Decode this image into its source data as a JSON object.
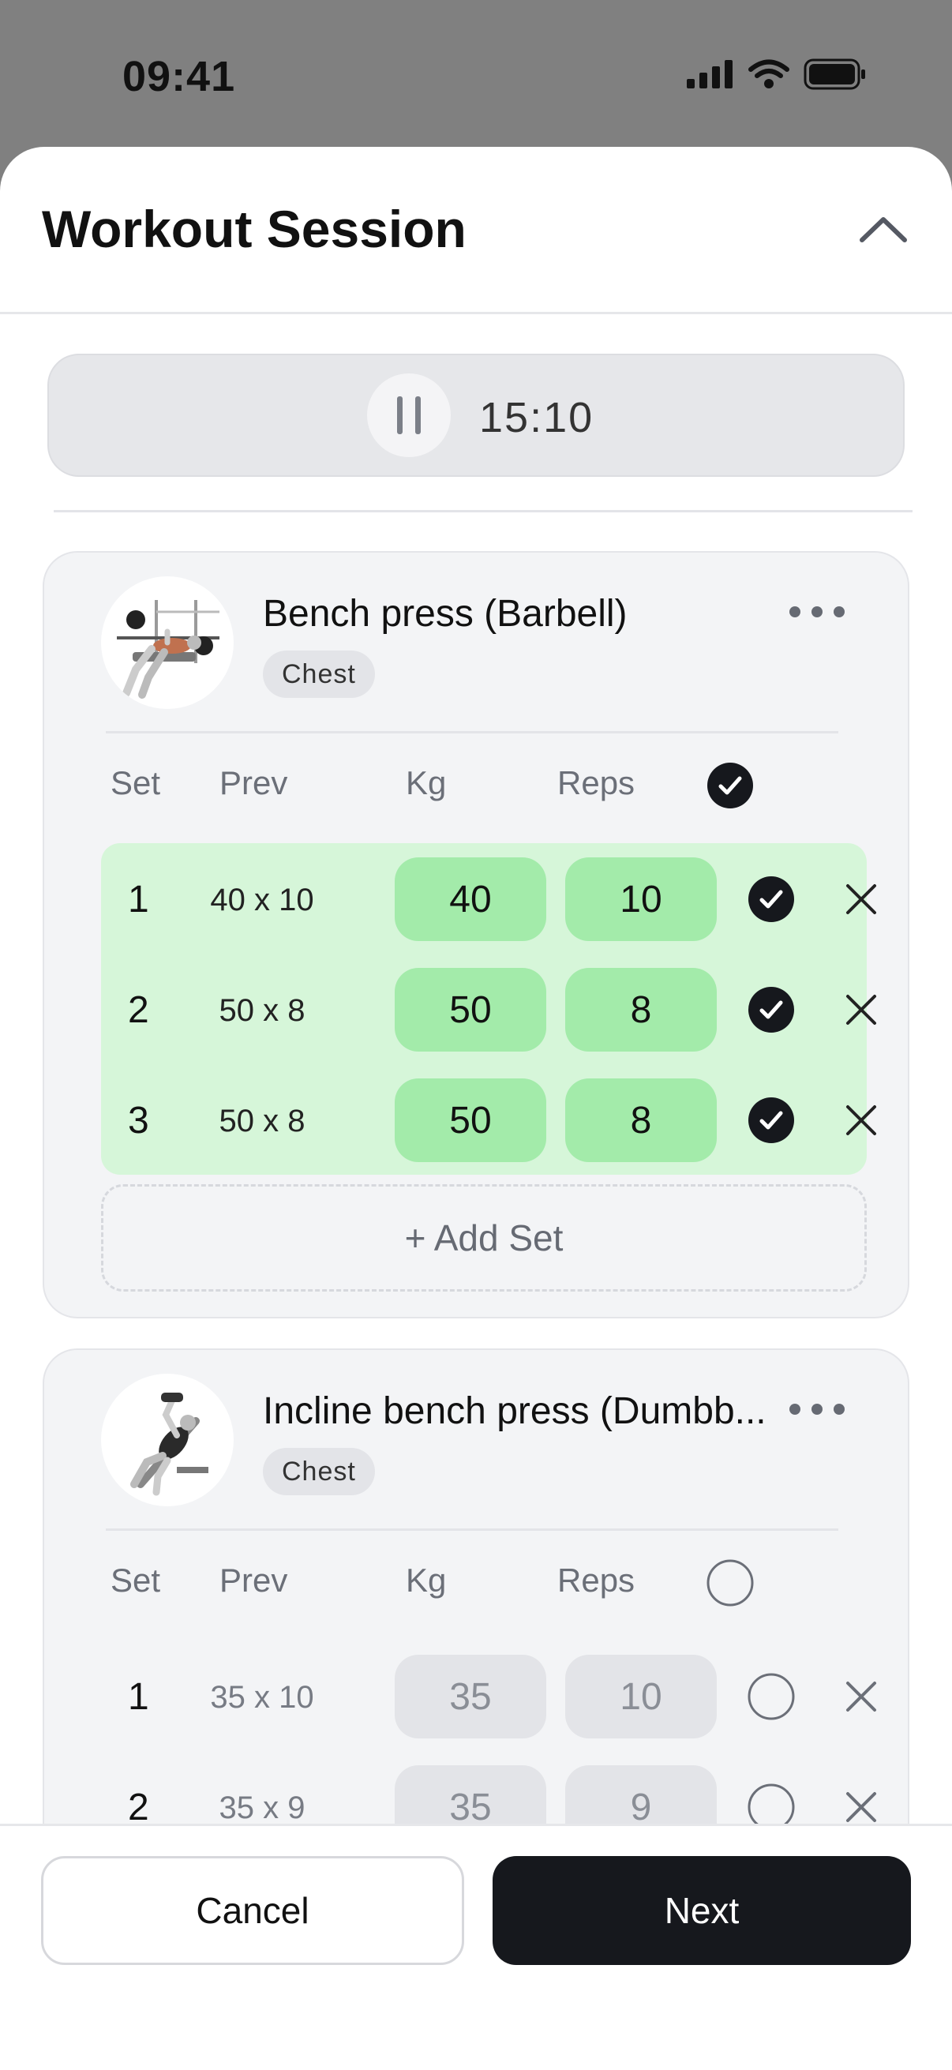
{
  "status_bar": {
    "time": "09:41",
    "icons": [
      "signal-icon",
      "wifi-icon",
      "battery-icon"
    ]
  },
  "sheet": {
    "title": "Workout Session",
    "collapse_icon": "chevron-up-icon"
  },
  "timer": {
    "value": "15:10",
    "icon": "pause-icon"
  },
  "columns": {
    "set": "Set",
    "prev": "Prev",
    "kg": "Kg",
    "reps": "Reps"
  },
  "add_set_label": "+ Add Set",
  "exercises": [
    {
      "name": "Bench press (Barbell)",
      "tag": "Chest",
      "header_checked": true,
      "sets": [
        {
          "set": "1",
          "prev": "40 x 10",
          "kg": "40",
          "reps": "10",
          "done": true
        },
        {
          "set": "2",
          "prev": "50 x 8",
          "kg": "50",
          "reps": "8",
          "done": true
        },
        {
          "set": "3",
          "prev": "50 x 8",
          "kg": "50",
          "reps": "8",
          "done": true
        }
      ]
    },
    {
      "name": "Incline bench press (Dumbb...",
      "tag": "Chest",
      "header_checked": false,
      "sets": [
        {
          "set": "1",
          "prev": "35 x 10",
          "kg": "35",
          "reps": "10",
          "done": false
        },
        {
          "set": "2",
          "prev": "35 x 9",
          "kg": "35",
          "reps": "9",
          "done": false
        }
      ]
    }
  ],
  "footer": {
    "cancel_label": "Cancel",
    "next_label": "Next"
  },
  "colors": {
    "done_row": "#d6f6d9",
    "done_cell": "#a3ebaa",
    "primary": "#16181d"
  }
}
